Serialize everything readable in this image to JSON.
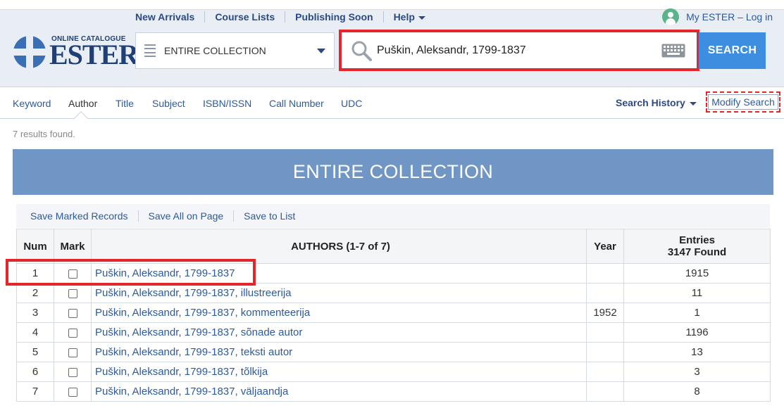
{
  "header": {
    "logo": {
      "small": "ONLINE CATALOGUE",
      "big": "ESTER"
    },
    "topnav": [
      {
        "label": "New Arrivals"
      },
      {
        "label": "Course Lists"
      },
      {
        "label": "Publishing Soon"
      },
      {
        "label": "Help"
      }
    ],
    "account": {
      "label": "My ESTER – Log in"
    },
    "scope": {
      "value": "ENTIRE COLLECTION"
    },
    "search": {
      "query": "Puškin, Aleksandr, 1799-1837",
      "button_label": "SEARCH"
    }
  },
  "tabs": [
    {
      "label": "Keyword"
    },
    {
      "label": "Author",
      "active": true
    },
    {
      "label": "Title"
    },
    {
      "label": "Subject"
    },
    {
      "label": "ISBN/ISSN"
    },
    {
      "label": "Call Number"
    },
    {
      "label": "UDC"
    }
  ],
  "search_history_label": "Search History",
  "modify_search_label": "Modify Search",
  "results_found": "7 results found.",
  "banner": "ENTIRE COLLECTION",
  "actions": [
    {
      "label": "Save Marked Records"
    },
    {
      "label": "Save All on Page"
    },
    {
      "label": "Save to List"
    }
  ],
  "table": {
    "headers": {
      "num": "Num",
      "mark": "Mark",
      "authors": "AUTHORS (1-7 of 7)",
      "year": "Year",
      "entries_line1": "Entries",
      "entries_line2": "3147 Found"
    },
    "rows": [
      {
        "num": "1",
        "author": "Puškin, Aleksandr, 1799-1837",
        "year": "",
        "entries": "1915"
      },
      {
        "num": "2",
        "author": "Puškin, Aleksandr, 1799-1837, illustreerija",
        "year": "",
        "entries": "11"
      },
      {
        "num": "3",
        "author": "Puškin, Aleksandr, 1799-1837, kommenteerija",
        "year": "1952",
        "entries": "1"
      },
      {
        "num": "4",
        "author": "Puškin, Aleksandr, 1799-1837, sõnade autor",
        "year": "",
        "entries": "1196"
      },
      {
        "num": "5",
        "author": "Puškin, Aleksandr, 1799-1837, teksti autor",
        "year": "",
        "entries": "13"
      },
      {
        "num": "6",
        "author": "Puškin, Aleksandr, 1799-1837, tõlkija",
        "year": "",
        "entries": "3"
      },
      {
        "num": "7",
        "author": "Puškin, Aleksandr, 1799-1837, väljaandja",
        "year": "",
        "entries": "8"
      }
    ]
  },
  "colors": {
    "accent": "#3d8ee0",
    "banner": "#7096c6",
    "highlight": "#e3262a",
    "link": "#2c5aa0"
  }
}
